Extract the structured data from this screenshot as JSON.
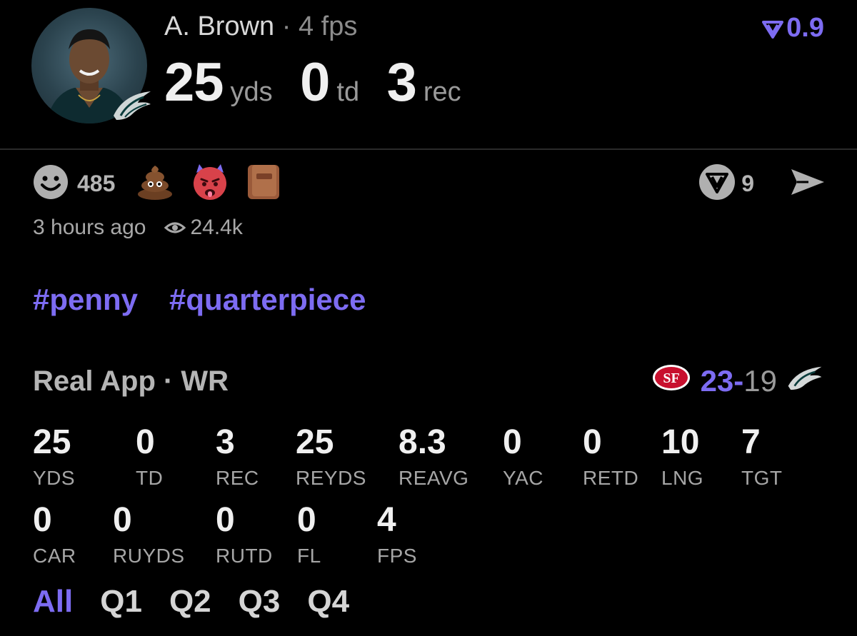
{
  "player": {
    "name": "A. Brown",
    "separator": "·",
    "fps_label": "4 fps",
    "team_logo": "eagles-logo",
    "statline": [
      {
        "value": "25",
        "unit": "yds"
      },
      {
        "value": "0",
        "unit": "td"
      },
      {
        "value": "3",
        "unit": "rec"
      }
    ]
  },
  "header_score": {
    "icon": "real-points-icon",
    "value": "0.9",
    "color": "#7d6cf2"
  },
  "reactions": {
    "smile_count": "485",
    "emojis": [
      "poop-emoji",
      "hot-devil-emoji",
      "book-emoji"
    ],
    "real_count": "9"
  },
  "meta": {
    "time": "3 hours ago",
    "views": "24.4k"
  },
  "tags": [
    "#penny",
    "#quarterpiece"
  ],
  "game": {
    "title": "Real App · WR",
    "opponent_logo": "49ers-logo",
    "score_win": "23",
    "score_dash": "-",
    "score_loss": "19",
    "team_logo": "eagles-logo"
  },
  "stats_row1": [
    {
      "value": "25",
      "label": "YDS"
    },
    {
      "value": "0",
      "label": "TD"
    },
    {
      "value": "3",
      "label": "REC"
    },
    {
      "value": "25",
      "label": "REYDS"
    },
    {
      "value": "8.3",
      "label": "REAVG"
    },
    {
      "value": "0",
      "label": "YAC"
    },
    {
      "value": "0",
      "label": "RETD"
    },
    {
      "value": "10",
      "label": "LNG"
    },
    {
      "value": "7",
      "label": "TGT"
    }
  ],
  "stats_row2": [
    {
      "value": "0",
      "label": "CAR"
    },
    {
      "value": "0",
      "label": "RUYDS"
    },
    {
      "value": "0",
      "label": "RUTD"
    },
    {
      "value": "0",
      "label": "FL"
    },
    {
      "value": "4",
      "label": "FPS"
    }
  ],
  "periods": [
    "All",
    "Q1",
    "Q2",
    "Q3",
    "Q4"
  ],
  "colors": {
    "accent": "#7d6cf2",
    "background": "#000000"
  }
}
